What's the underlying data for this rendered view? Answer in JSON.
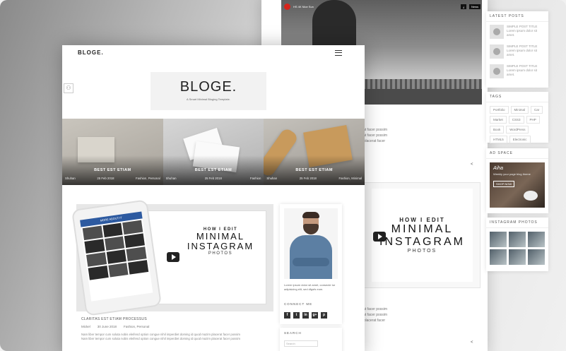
{
  "back": {
    "video_title": "HS 4K Nice Sun",
    "video_chip1": "⤓",
    "video_chip2": "News",
    "text_line_top": "r",
    "text_block1": "conque nibh Imperdiet doming id quod mazim placerat facer possim\nconque nibh Imperdiet doming id quod mazim placerat facer possim\noption congue nihil imperdiet doming id quod mazim placerat facer",
    "text_block2": "conque nibh Imperdiet doming id quod mazim placerat facer possim\nconque nibh Imperdiet doming id quod mazim placerat facer possim\noption congue nihil imperdiet doming id quod mazim placerat facer",
    "card": {
      "small": "HOW I EDIT",
      "big1": "MINIMAL",
      "big2": "INSTAGRAM",
      "photos": "PHOTOS"
    }
  },
  "sidebar_right": {
    "latest_title": "LATEST POSTS",
    "latest": [
      {
        "title": "SIMPLE POST TITLE",
        "text": "Lorem ipsum dolor sit amet."
      },
      {
        "title": "SIMPLE POST TITLE",
        "text": "Lorem ipsum dolor sit amet."
      },
      {
        "title": "SIMPLE POST TITLE",
        "text": "Lorem ipsum dolor sit amet."
      }
    ],
    "tags_title": "TAGS",
    "tags": [
      "Portfolio",
      "Minimal",
      "Car",
      "Market",
      "CSS3",
      "PHP",
      "Book",
      "WordPress",
      "HTML5",
      "Electronic"
    ],
    "ad_title": "AD SPACE",
    "ad": {
      "brand": "Aiha",
      "sub": "Weekly your page blog theme",
      "button": "SHOP NOW"
    },
    "insta_title": "INSTAGRAM PHOTOS"
  },
  "front": {
    "nav_logo": "BLOGE.",
    "logo_big": "BLOGE.",
    "logo_tag": "A Smart Minimal Bloging Template.",
    "slides": [
      {
        "title": "BEST EST ETIAM",
        "author": "Shuhan",
        "date": "25 Feb 2018",
        "cat": "Fashion, Personal"
      },
      {
        "title": "BEST EST ETIAM",
        "author": "Shuhan",
        "date": "25 Feb 2018",
        "cat": "Fashion"
      },
      {
        "title": "BEST EST ETIAM",
        "author": "Shuhan",
        "date": "25 Feb 2018",
        "cat": "Fashion, Minimal"
      }
    ],
    "post": {
      "insta_label": "MORE ABOUT IT",
      "small": "HOW I EDIT",
      "big1": "MINIMAL",
      "big2": "INSTAGRAM",
      "photos": "PHOTOS",
      "category": "CLARITAS EST ETIAM PROCESSUS",
      "author": "Mickel",
      "date": "30 June 2018",
      "cats": "Fashion, Personal",
      "excerpt": "Nam liber tempor cum soluta nobis eleifend option congue nihil imperdiet doming id quod mazim placerat facer possim\nNam liber tempor cum soluta nobis eleifend option congue nihil imperdiet doming id quod mazim placerat facer possim"
    },
    "author_widget": {
      "text": "Lorem ipsum dolor sit amet, consecte tur adipisicing elit, sed dfgsfs eum.",
      "connect": "CONNECT ME",
      "social": [
        "f",
        "t",
        "in",
        "g+",
        "p"
      ]
    },
    "search": {
      "label": "SEARCH",
      "placeholder": "Search"
    }
  }
}
